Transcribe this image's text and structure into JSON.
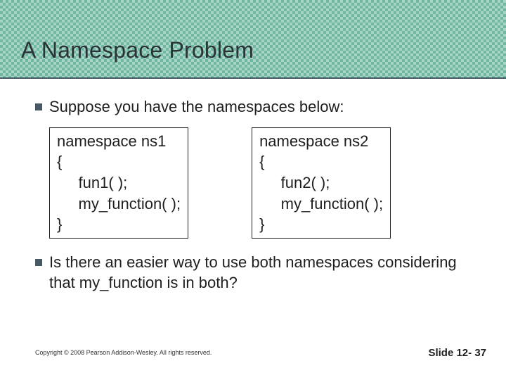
{
  "header": {
    "title": "A Namespace Problem"
  },
  "body": {
    "bullet1": "Suppose you have the namespaces below:",
    "code_box_left": "namespace ns1\n{\n     fun1( );\n     my_function( );\n}",
    "code_box_right": "namespace ns2\n{\n     fun2( );\n     my_function( );\n}",
    "bullet2": "Is there an easier way to use both namespaces considering that my_function is in both?"
  },
  "footer": {
    "copyright": "Copyright © 2008 Pearson Addison-Wesley. All rights reserved.",
    "slide_label": "Slide 12- 37"
  }
}
